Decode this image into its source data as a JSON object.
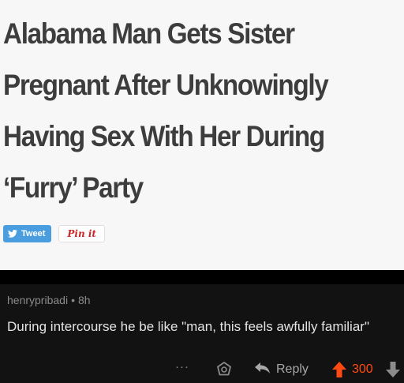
{
  "article": {
    "headline_lines": [
      "Alabama Man Gets Sister",
      "Pregnant After Unknowingly",
      "Having Sex With Her During",
      "‘Furry’ Party"
    ],
    "share": {
      "tweet_label": "Tweet",
      "pin_label": "Pin it"
    }
  },
  "comment": {
    "username": "henrypribadi",
    "separator": "•",
    "age": "8h",
    "text": "During intercourse he be like \"man, this feels awfully familiar\"",
    "actions": {
      "more_label": "···",
      "reply_label": "Reply",
      "score": "300"
    }
  },
  "colors": {
    "upvote": "#ff4a12",
    "muted": "#8b8b8b",
    "tweet_blue": "#4a9ee0",
    "pin_red": "#c62828"
  },
  "icons": [
    "twitter-bird-icon",
    "award-icon",
    "reply-arrow-icon",
    "upvote-arrow-icon",
    "downvote-arrow-icon"
  ]
}
